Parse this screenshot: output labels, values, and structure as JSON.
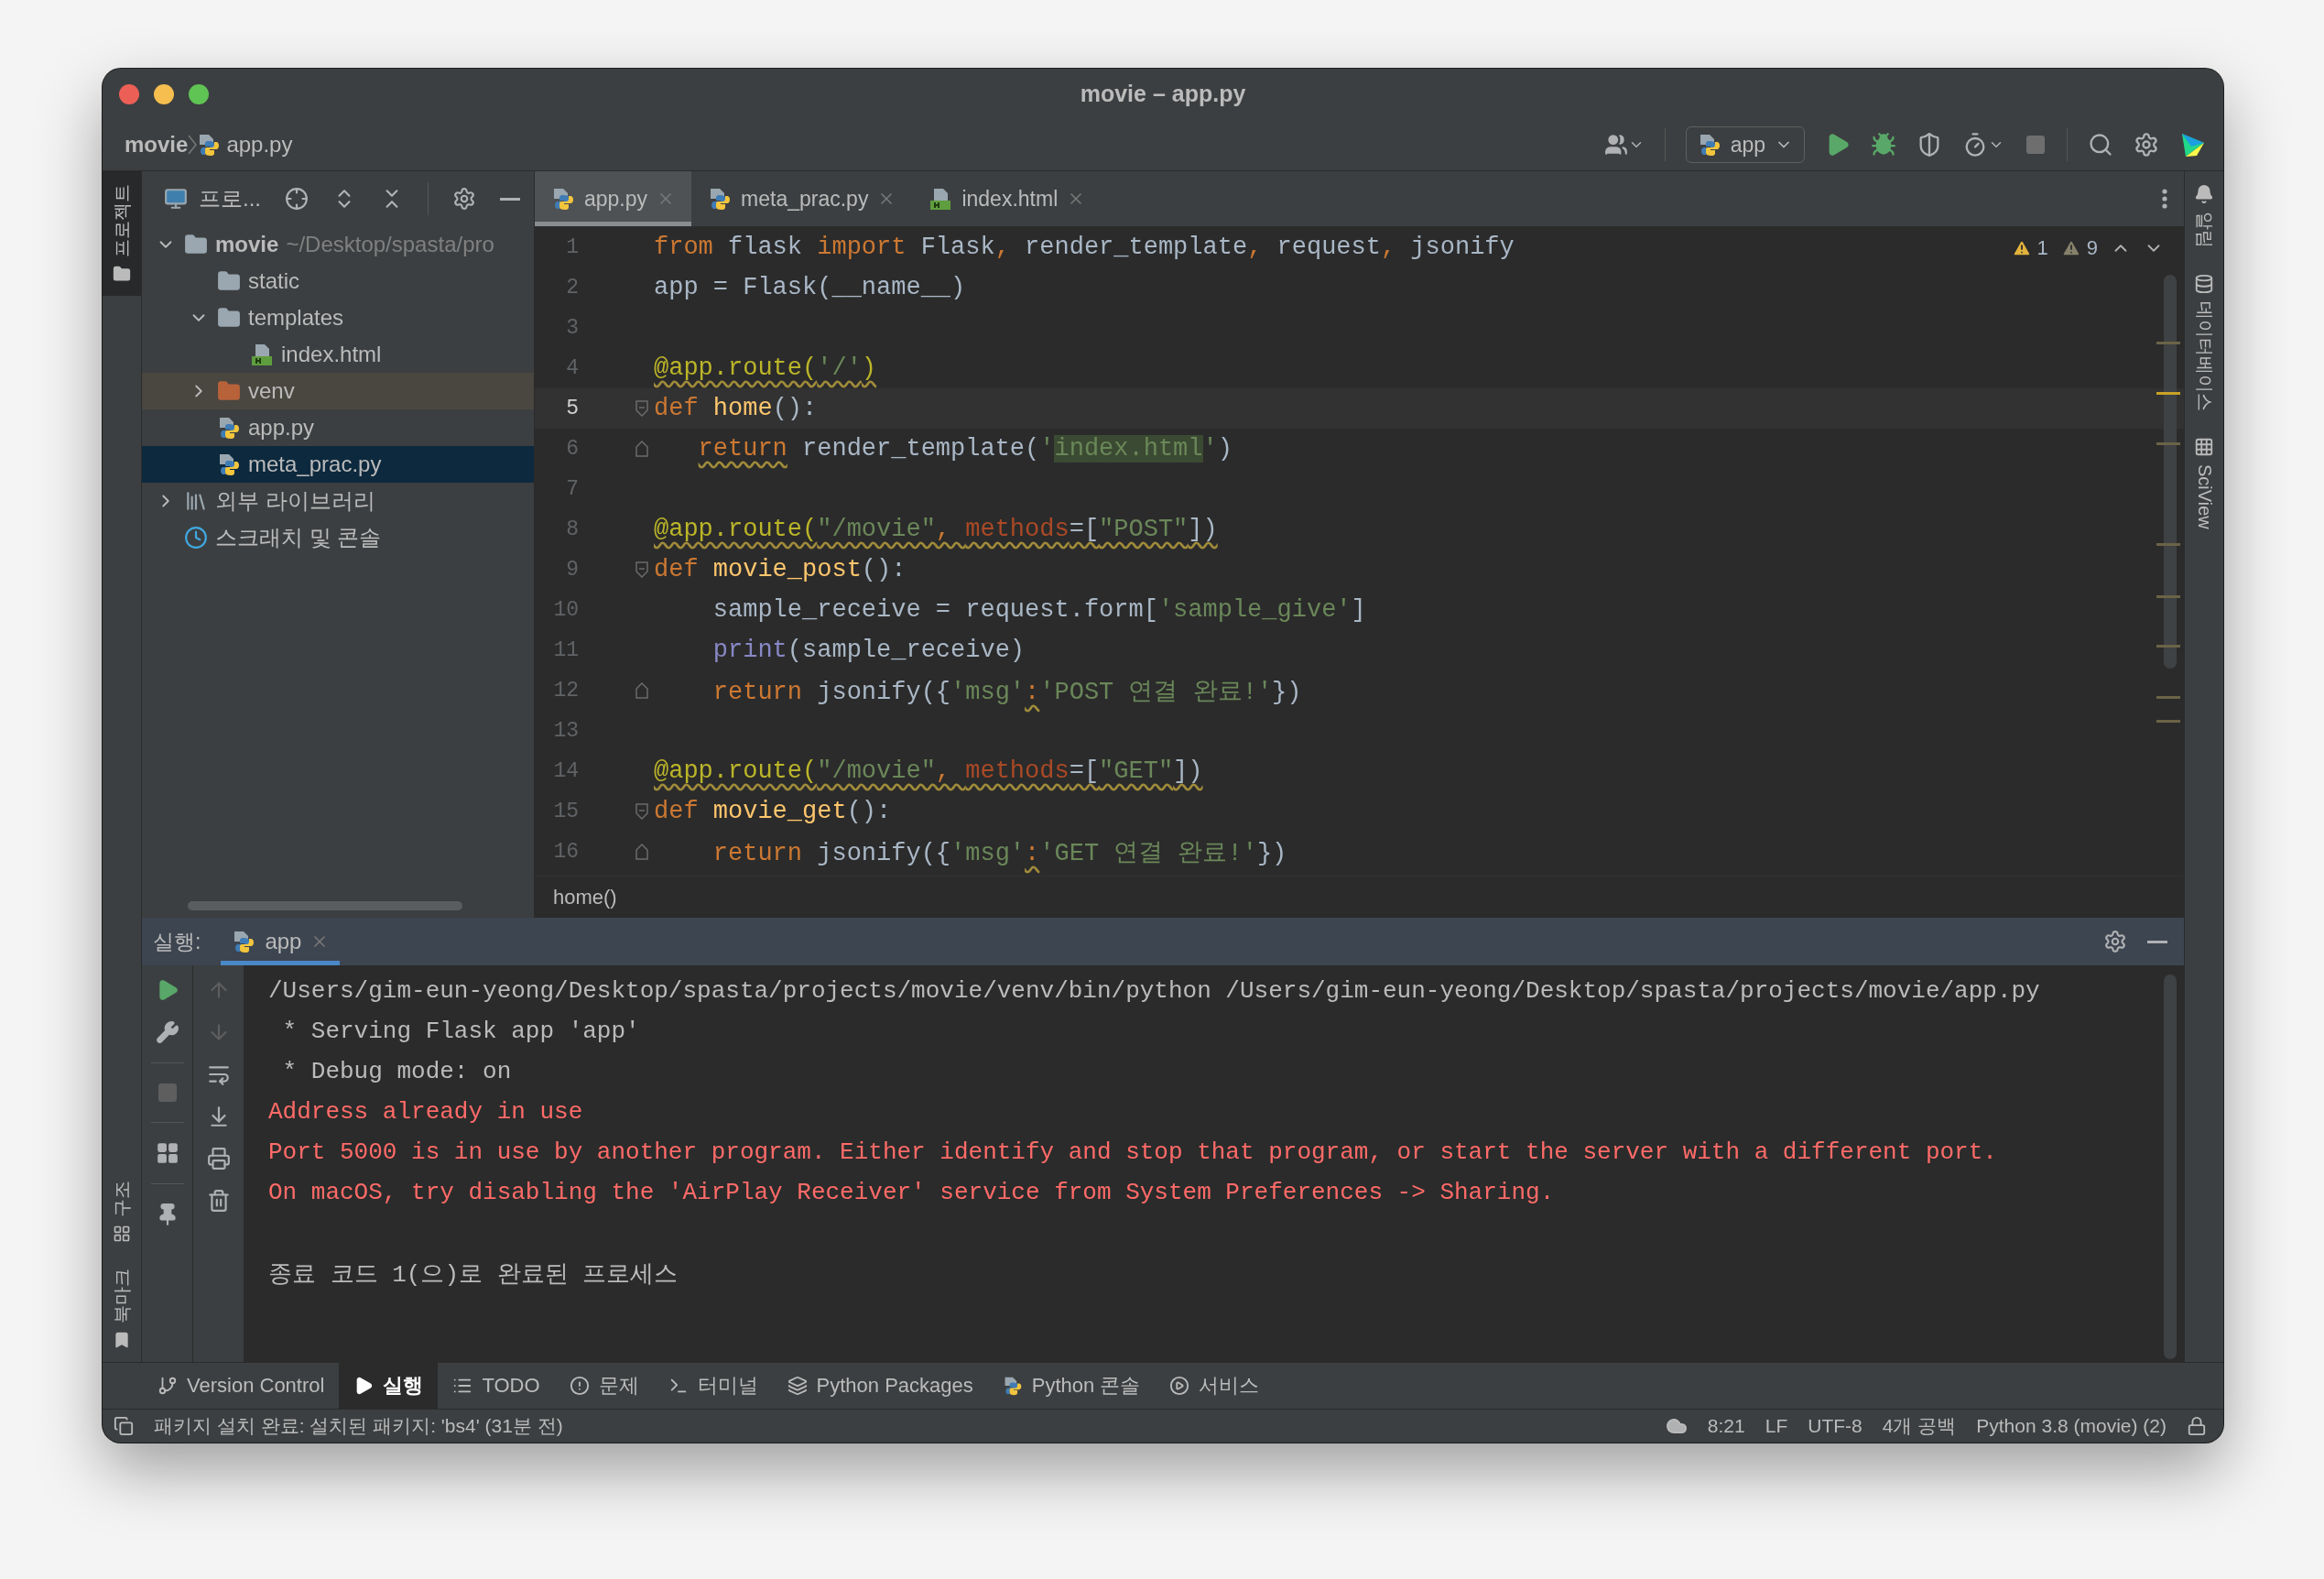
{
  "window": {
    "title": "movie – app.py"
  },
  "navbar": {
    "breadcrumb": [
      {
        "label": "movie",
        "kind": "project"
      },
      {
        "label": "app.py",
        "kind": "python"
      }
    ],
    "run_config": "app"
  },
  "project_panel": {
    "title": "프로...",
    "tree": [
      {
        "label": "movie",
        "detail": "~/Desktop/spasta/pro",
        "kind": "project",
        "expanded": true,
        "selected": false,
        "children": [
          {
            "label": "static",
            "kind": "folder",
            "selected": false
          },
          {
            "label": "templates",
            "kind": "folder",
            "expanded": true,
            "selected": false,
            "children": [
              {
                "label": "index.html",
                "kind": "html",
                "selected": false
              }
            ]
          },
          {
            "label": "venv",
            "kind": "excluded",
            "expanded": false,
            "selected": false
          },
          {
            "label": "app.py",
            "kind": "python",
            "selected": false
          },
          {
            "label": "meta_prac.py",
            "kind": "python",
            "selected": true
          }
        ]
      },
      {
        "label": "외부 라이브러리",
        "kind": "library",
        "expanded": false,
        "selected": false
      },
      {
        "label": "스크래치 및 콘솔",
        "kind": "scratch",
        "selected": false
      }
    ]
  },
  "tool_stripes": {
    "left_top": [
      {
        "label": "프로젝트",
        "selected": true
      }
    ],
    "left_bottom": [
      {
        "label": "구조",
        "kind": "structure"
      },
      {
        "label": "북마크",
        "kind": "bookmark"
      }
    ],
    "right": [
      {
        "label": "알림",
        "kind": "bell"
      },
      {
        "label": "데이터베이스",
        "kind": "database"
      },
      {
        "label": "SciView",
        "kind": "grid"
      }
    ]
  },
  "editor": {
    "tabs": [
      {
        "label": "app.py",
        "kind": "python",
        "selected": true
      },
      {
        "label": "meta_prac.py",
        "kind": "python",
        "selected": false
      },
      {
        "label": "index.html",
        "kind": "html",
        "selected": false
      }
    ],
    "inspections": {
      "warnings": "1",
      "weak_warnings": "9"
    },
    "lines": [
      {
        "number": "1",
        "current": false,
        "fold_start": false,
        "fold_end": false,
        "tokens": [
          {
            "text": "from",
            "kind": "keyword",
            "warn": false
          },
          {
            "text": " flask ",
            "kind": "plain",
            "warn": false
          },
          {
            "text": "import",
            "kind": "keyword",
            "warn": false
          },
          {
            "text": " Flask",
            "kind": "plain",
            "warn": false
          },
          {
            "text": ", ",
            "kind": "keyword",
            "warn": false
          },
          {
            "text": "render_template",
            "kind": "plain",
            "warn": false
          },
          {
            "text": ", ",
            "kind": "keyword",
            "warn": false
          },
          {
            "text": "request",
            "kind": "plain",
            "warn": false
          },
          {
            "text": ", ",
            "kind": "keyword",
            "warn": false
          },
          {
            "text": "jsonify",
            "kind": "plain",
            "warn": false
          }
        ]
      },
      {
        "number": "2",
        "current": false,
        "fold_start": false,
        "fold_end": false,
        "tokens": [
          {
            "text": "app = Flask(__name__)",
            "kind": "plain",
            "warn": false
          }
        ]
      },
      {
        "number": "3",
        "current": false,
        "fold_start": false,
        "fold_end": false
      },
      {
        "number": "4",
        "current": false,
        "fold_start": false,
        "fold_end": false,
        "tokens": [
          {
            "text": "@app.route(",
            "kind": "decorator",
            "warn": true
          },
          {
            "text": "'/'",
            "kind": "string",
            "warn": true
          },
          {
            "text": ")",
            "kind": "decorator",
            "warn": true
          }
        ]
      },
      {
        "number": "5",
        "current": true,
        "fold_start": true,
        "fold_end": false,
        "tokens": [
          {
            "text": "def ",
            "kind": "keyword",
            "warn": false
          },
          {
            "text": "home",
            "kind": "function",
            "warn": false
          },
          {
            "text": "():",
            "kind": "plain",
            "warn": false
          }
        ]
      },
      {
        "number": "6",
        "current": false,
        "fold_start": false,
        "fold_end": true,
        "tokens": [
          {
            "text": "   return",
            "kind": "keyword",
            "warn": true
          },
          {
            "text": " render_template(",
            "kind": "plain",
            "warn": false
          },
          {
            "text": "'",
            "kind": "string",
            "warn": false
          },
          {
            "text": "index.html",
            "kind": "string-match",
            "warn": false
          },
          {
            "text": "'",
            "kind": "string",
            "warn": false
          },
          {
            "text": ")",
            "kind": "plain",
            "warn": false
          }
        ]
      },
      {
        "number": "7",
        "current": false,
        "fold_start": false,
        "fold_end": false
      },
      {
        "number": "8",
        "current": false,
        "fold_start": false,
        "fold_end": false,
        "tokens": [
          {
            "text": "@app.route(",
            "kind": "decorator",
            "warn": true
          },
          {
            "text": "\"/movie\"",
            "kind": "string",
            "warn": true
          },
          {
            "text": ", ",
            "kind": "keyword",
            "warn": true
          },
          {
            "text": "methods",
            "kind": "param",
            "warn": true
          },
          {
            "text": "=[",
            "kind": "plain",
            "warn": true
          },
          {
            "text": "\"POST\"",
            "kind": "string",
            "warn": true
          },
          {
            "text": "])",
            "kind": "plain",
            "warn": true
          }
        ]
      },
      {
        "number": "9",
        "current": false,
        "fold_start": true,
        "fold_end": false,
        "tokens": [
          {
            "text": "def ",
            "kind": "keyword",
            "warn": false
          },
          {
            "text": "movie_post",
            "kind": "function",
            "warn": false
          },
          {
            "text": "():",
            "kind": "plain",
            "warn": false
          }
        ]
      },
      {
        "number": "10",
        "current": false,
        "fold_start": false,
        "fold_end": false,
        "tokens": [
          {
            "text": "    sample_receive = request.form[",
            "kind": "plain",
            "warn": false
          },
          {
            "text": "'sample_give'",
            "kind": "string",
            "warn": false
          },
          {
            "text": "]",
            "kind": "plain",
            "warn": false
          }
        ]
      },
      {
        "number": "11",
        "current": false,
        "fold_start": false,
        "fold_end": false,
        "tokens": [
          {
            "text": "    print",
            "kind": "builtin",
            "warn": false
          },
          {
            "text": "(sample_receive)",
            "kind": "plain",
            "warn": false
          }
        ]
      },
      {
        "number": "12",
        "current": false,
        "fold_start": false,
        "fold_end": true,
        "tokens": [
          {
            "text": "    return",
            "kind": "keyword",
            "warn": false
          },
          {
            "text": " jsonify({",
            "kind": "plain",
            "warn": false
          },
          {
            "text": "'msg'",
            "kind": "string",
            "warn": false
          },
          {
            "text": ":",
            "kind": "keyword",
            "warn": true
          },
          {
            "text": "'POST 연결 완료!'",
            "kind": "string",
            "warn": false
          },
          {
            "text": "})",
            "kind": "plain",
            "warn": false
          }
        ]
      },
      {
        "number": "13",
        "current": false,
        "fold_start": false,
        "fold_end": false
      },
      {
        "number": "14",
        "current": false,
        "fold_start": false,
        "fold_end": false,
        "tokens": [
          {
            "text": "@app.route(",
            "kind": "decorator",
            "warn": true
          },
          {
            "text": "\"/movie\"",
            "kind": "string",
            "warn": true
          },
          {
            "text": ", ",
            "kind": "keyword",
            "warn": true
          },
          {
            "text": "methods",
            "kind": "param",
            "warn": true
          },
          {
            "text": "=[",
            "kind": "plain",
            "warn": true
          },
          {
            "text": "\"GET\"",
            "kind": "string",
            "warn": true
          },
          {
            "text": "])",
            "kind": "plain",
            "warn": true
          }
        ]
      },
      {
        "number": "15",
        "current": false,
        "fold_start": true,
        "fold_end": false,
        "tokens": [
          {
            "text": "def ",
            "kind": "keyword",
            "warn": false
          },
          {
            "text": "movie_get",
            "kind": "function",
            "warn": false
          },
          {
            "text": "():",
            "kind": "plain",
            "warn": false
          }
        ]
      },
      {
        "number": "16",
        "current": false,
        "fold_start": false,
        "fold_end": true,
        "tokens": [
          {
            "text": "    return",
            "kind": "keyword",
            "warn": false
          },
          {
            "text": " jsonify({",
            "kind": "plain",
            "warn": false
          },
          {
            "text": "'msg'",
            "kind": "string",
            "warn": false
          },
          {
            "text": ":",
            "kind": "keyword",
            "warn": true
          },
          {
            "text": "'GET 연결 완료!'",
            "kind": "string",
            "warn": false
          },
          {
            "text": "})",
            "kind": "plain",
            "warn": false
          }
        ]
      }
    ],
    "breadcrumb": "home()"
  },
  "run_panel": {
    "label": "실행:",
    "tabs": [
      {
        "label": "app",
        "selected": true
      }
    ],
    "console": [
      {
        "text": "/Users/gim-eun-yeong/Desktop/spasta/projects/movie/venv/bin/python /Users/gim-eun-yeong/Desktop/spasta/projects/movie/app.py",
        "kind": "output"
      },
      {
        "text": " * Serving Flask app 'app'",
        "kind": "output"
      },
      {
        "text": " * Debug mode: on",
        "kind": "output"
      },
      {
        "text": "Address already in use",
        "kind": "error"
      },
      {
        "text": "Port 5000 is in use by another program. Either identify and stop that program, or start the server with a different port.",
        "kind": "error"
      },
      {
        "text": "On macOS, try disabling the 'AirPlay Receiver' service from System Preferences -> Sharing.",
        "kind": "error"
      },
      {
        "kind": "blank"
      },
      {
        "text": "종료 코드 1(으)로 완료된 프로세스",
        "kind": "output"
      }
    ]
  },
  "tool_windows": [
    {
      "label": "Version Control",
      "kind": "vcs",
      "selected": false
    },
    {
      "label": "실행",
      "kind": "run",
      "selected": true
    },
    {
      "label": "TODO",
      "kind": "todo",
      "selected": false
    },
    {
      "label": "문제",
      "kind": "problems",
      "selected": false
    },
    {
      "label": "터미널",
      "kind": "terminal",
      "selected": false
    },
    {
      "label": "Python Packages",
      "kind": "packages",
      "selected": false
    },
    {
      "label": "Python 콘솔",
      "kind": "python",
      "selected": false
    },
    {
      "label": "서비스",
      "kind": "services",
      "selected": false
    }
  ],
  "status_bar": {
    "message": "패키지 설치 완료: 설치된 패키지: 'bs4' (31분 전)",
    "items": [
      "8:21",
      "LF",
      "UTF-8",
      "4개 공백",
      "Python 3.8 (movie) (2)"
    ]
  }
}
